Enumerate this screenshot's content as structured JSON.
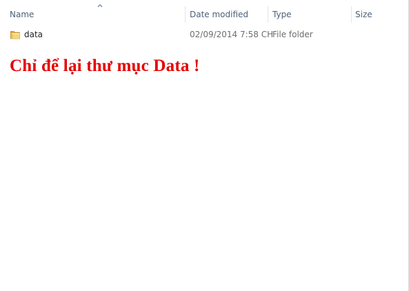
{
  "columns": {
    "name": "Name",
    "date_modified": "Date modified",
    "type": "Type",
    "size": "Size"
  },
  "sort": {
    "column": "name",
    "direction": "ascending",
    "icon": "sort-up-icon"
  },
  "files": [
    {
      "name": "data",
      "date_modified": "02/09/2014 7:58 CH",
      "type": "File folder",
      "size": "",
      "icon": "folder-icon"
    }
  ],
  "annotation": {
    "text": "Chỉ để lại thư mục Data !",
    "color": "#e60000"
  },
  "colors": {
    "header_text": "#4c607a",
    "secondary_text": "#6d6d6d",
    "folder_yellow": "#e8c15a"
  }
}
